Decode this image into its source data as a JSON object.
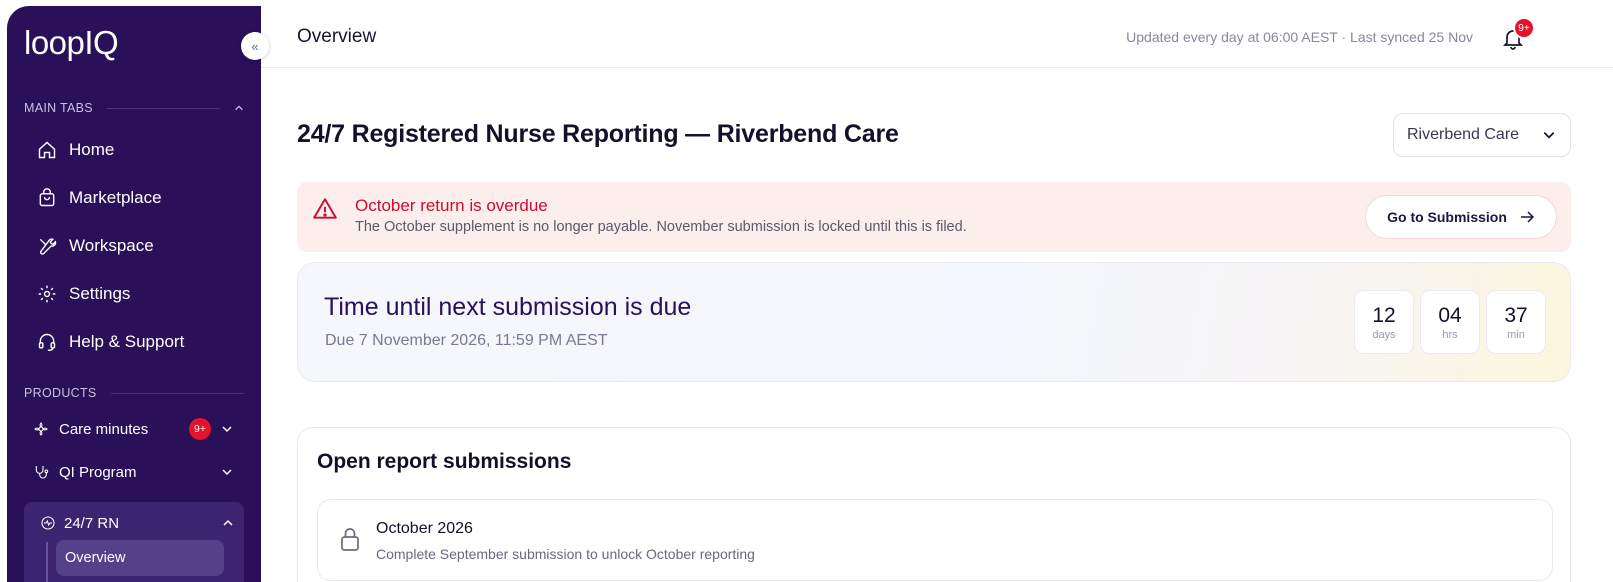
{
  "brand": {
    "logo_text": "loopIQ"
  },
  "sidebar": {
    "collapse_glyph": "«",
    "main_tabs_label": "MAIN TABS",
    "main_items": [
      {
        "label": "Home",
        "icon": "home-icon"
      },
      {
        "label": "Marketplace",
        "icon": "shopping-bag-icon"
      },
      {
        "label": "Workspace",
        "icon": "tools-icon"
      },
      {
        "label": "Settings",
        "icon": "gear-icon"
      },
      {
        "label": "Help & Support",
        "icon": "headset-icon"
      }
    ],
    "products_label": "PRODUCTS",
    "products": [
      {
        "label": "Care minutes",
        "badge": "9+",
        "icon": "flower-icon"
      },
      {
        "label": "QI Program",
        "icon": "stethoscope-icon"
      },
      {
        "label": "24/7 RN",
        "icon": "heartbeat-icon",
        "sub": "Overview"
      }
    ]
  },
  "topbar": {
    "title": "Overview",
    "sync_text": "Updated every day at 06:00 AEST · Last synced 25 Nov",
    "notification_badge": "9+"
  },
  "main": {
    "heading": "24/7 Registered Nurse Reporting — Riverbend Care",
    "facility_select": "Riverbend Care",
    "alert": {
      "title": "October return is overdue",
      "body": "The October supplement is no longer payable. November submission is locked until this is filed.",
      "button": "Go to Submission",
      "color": "#c8102e"
    },
    "countdown": {
      "title": "Time until next submission is due",
      "subtitle": "Due 7 November 2026, 11:59 PM AEST",
      "days": "12",
      "days_label": "days",
      "hours": "04",
      "hours_label": "hrs",
      "minutes": "37",
      "minutes_label": "min"
    },
    "submissions": {
      "title": "Open report submissions",
      "items": [
        {
          "name": "October 2026",
          "desc": "Complete September submission to unlock October reporting",
          "icon": "lock-icon"
        }
      ]
    }
  },
  "colors": {
    "sidebar_bg": "#2a1058",
    "accent": "#2a1058",
    "danger": "#e3142a"
  }
}
